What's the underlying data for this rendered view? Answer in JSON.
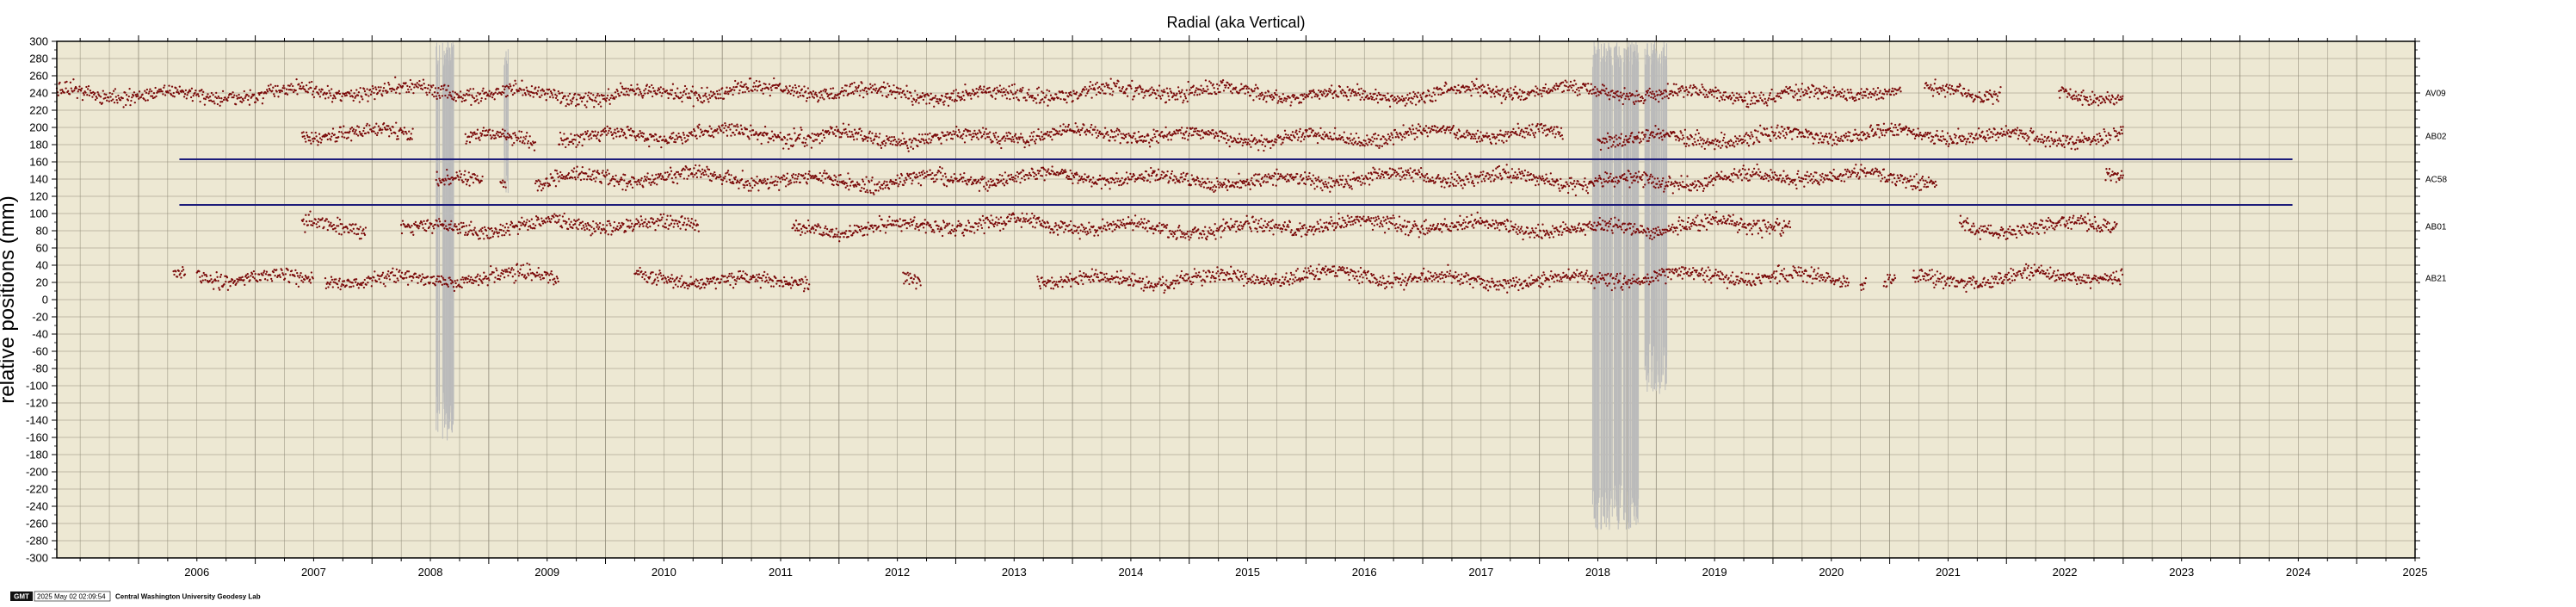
{
  "chart_data": {
    "type": "scatter",
    "title": "Radial (aka Vertical)",
    "ylabel": "relative positions (mm)",
    "xlabel": "",
    "xlim": [
      2005.3,
      2025.5
    ],
    "ylim": [
      -300,
      300
    ],
    "y_tick_step": 20,
    "x_tick_labels": [
      "2006",
      "2007",
      "2008",
      "2009",
      "2010",
      "2011",
      "2012",
      "2013",
      "2014",
      "2015",
      "2016",
      "2017",
      "2018",
      "2019",
      "2020",
      "2021",
      "2022",
      "2023",
      "2024",
      "2025"
    ],
    "grid": true,
    "background_color": "#ede8d3",
    "point_color": "#7a0a0a",
    "error_bar_color": "#bbbbbb",
    "series": [
      {
        "name": "AV09",
        "level": 240,
        "segments": [
          [
            2005.3,
            2021.1
          ],
          [
            2021.3,
            2021.95
          ],
          [
            2022.45,
            2023.0
          ]
        ]
      },
      {
        "name": "AB02",
        "level": 190,
        "segments": [
          [
            2007.4,
            2008.35
          ],
          [
            2008.8,
            2009.4
          ],
          [
            2009.6,
            2018.2
          ],
          [
            2018.5,
            2022.9
          ],
          [
            2022.92,
            2023.0
          ]
        ]
      },
      {
        "name": "AC58",
        "level": 140,
        "segments": [
          [
            2008.55,
            2008.95
          ],
          [
            2009.1,
            2009.15
          ],
          [
            2009.4,
            2021.4
          ],
          [
            2022.85,
            2023.0
          ]
        ]
      },
      {
        "name": "AB01",
        "level": 85,
        "segments": [
          [
            2007.4,
            2007.95
          ],
          [
            2008.25,
            2010.8
          ],
          [
            2011.6,
            2020.15
          ],
          [
            2021.6,
            2022.95
          ]
        ]
      },
      {
        "name": "AB21",
        "level": 25,
        "segments": [
          [
            2006.3,
            2006.4
          ],
          [
            2006.5,
            2007.5
          ],
          [
            2007.6,
            2009.6
          ],
          [
            2010.25,
            2011.75
          ],
          [
            2012.55,
            2012.7
          ],
          [
            2013.7,
            2020.65
          ],
          [
            2020.75,
            2020.8
          ],
          [
            2020.95,
            2021.05
          ],
          [
            2021.2,
            2023.0
          ]
        ]
      }
    ],
    "reference_lines": [
      {
        "y": 163,
        "x_range": [
          2006.35,
          2024.45
        ],
        "color": "#1c1c7a"
      },
      {
        "y": 110,
        "x_range": [
          2006.35,
          2024.45
        ],
        "color": "#1c1c7a"
      }
    ],
    "outlier_bands": [
      {
        "x_range": [
          2008.55,
          2008.7
        ],
        "y_range": [
          -165,
          300
        ]
      },
      {
        "x_range": [
          2009.13,
          2009.17
        ],
        "y_range": [
          120,
          300
        ]
      },
      {
        "x_range": [
          2018.45,
          2018.85
        ],
        "y_range": [
          -270,
          300
        ]
      },
      {
        "x_range": [
          2018.9,
          2019.1
        ],
        "y_range": [
          -110,
          300
        ]
      }
    ]
  },
  "footer": {
    "logo_text": "GMT",
    "timestamp": "2025 May 02 02:09:54",
    "credit": "Central Washington University Geodesy Lab"
  }
}
